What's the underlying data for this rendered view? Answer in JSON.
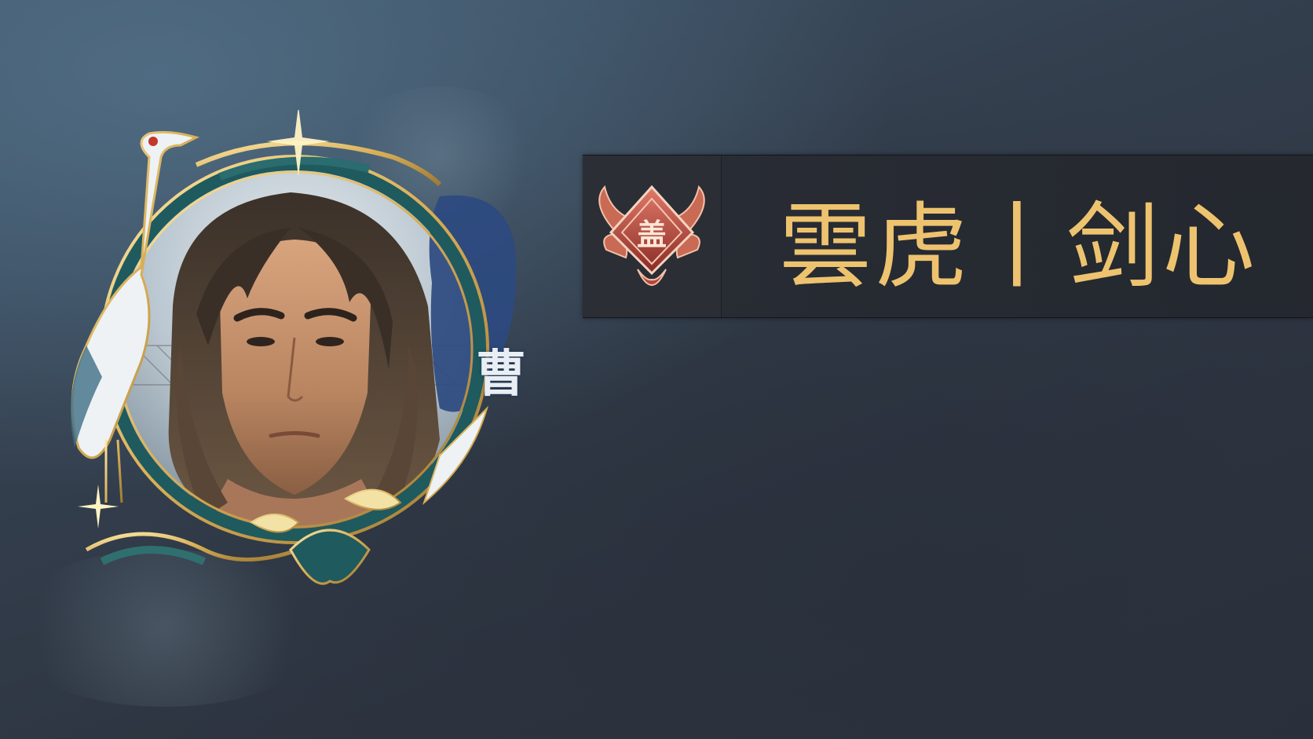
{
  "character": {
    "surname_badge": "曹",
    "display_name": "雲虎丨剑心",
    "emblem_char": "盖",
    "portrait_icon": "character-portrait",
    "frame_icon": "crane-frame-icon"
  },
  "colors": {
    "name_gold": "#eec36f",
    "plate_dark": "#282c34",
    "badge_blue": "#2c4a80",
    "emblem_red": "#b5443c"
  }
}
